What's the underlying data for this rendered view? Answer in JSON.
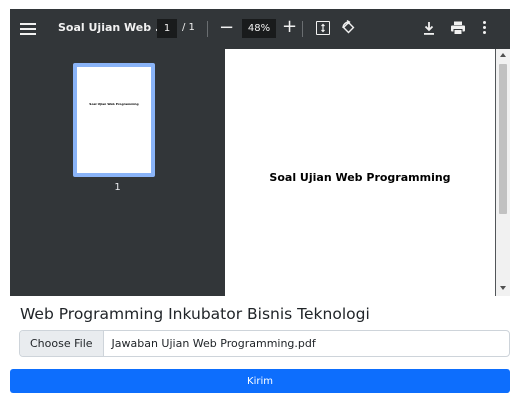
{
  "viewer": {
    "title": "Soal Ujian Web ...",
    "page_current": "1",
    "page_total": "/ 1",
    "zoom_out": "−",
    "zoom": "48%",
    "zoom_in": "+",
    "thumbnail_text": "Soal Ujian Web Programming",
    "thumbnail_label": "1",
    "page_heading": "Soal Ujian Web Programming"
  },
  "form": {
    "title": "Web Programming Inkubator Bisnis Teknologi",
    "choose_file_label": "Choose File",
    "file_name": "Jawaban Ujian Web Programming.pdf",
    "submit_label": "Kirim"
  },
  "colors": {
    "toolbar": "#323639",
    "viewer_bg": "#525659",
    "thumb_highlight": "#8ab4f8",
    "primary": "#0d6efd"
  },
  "icons": [
    "menu-icon",
    "fit-page-icon",
    "rotate-icon",
    "download-icon",
    "print-icon",
    "more-vert-icon"
  ]
}
